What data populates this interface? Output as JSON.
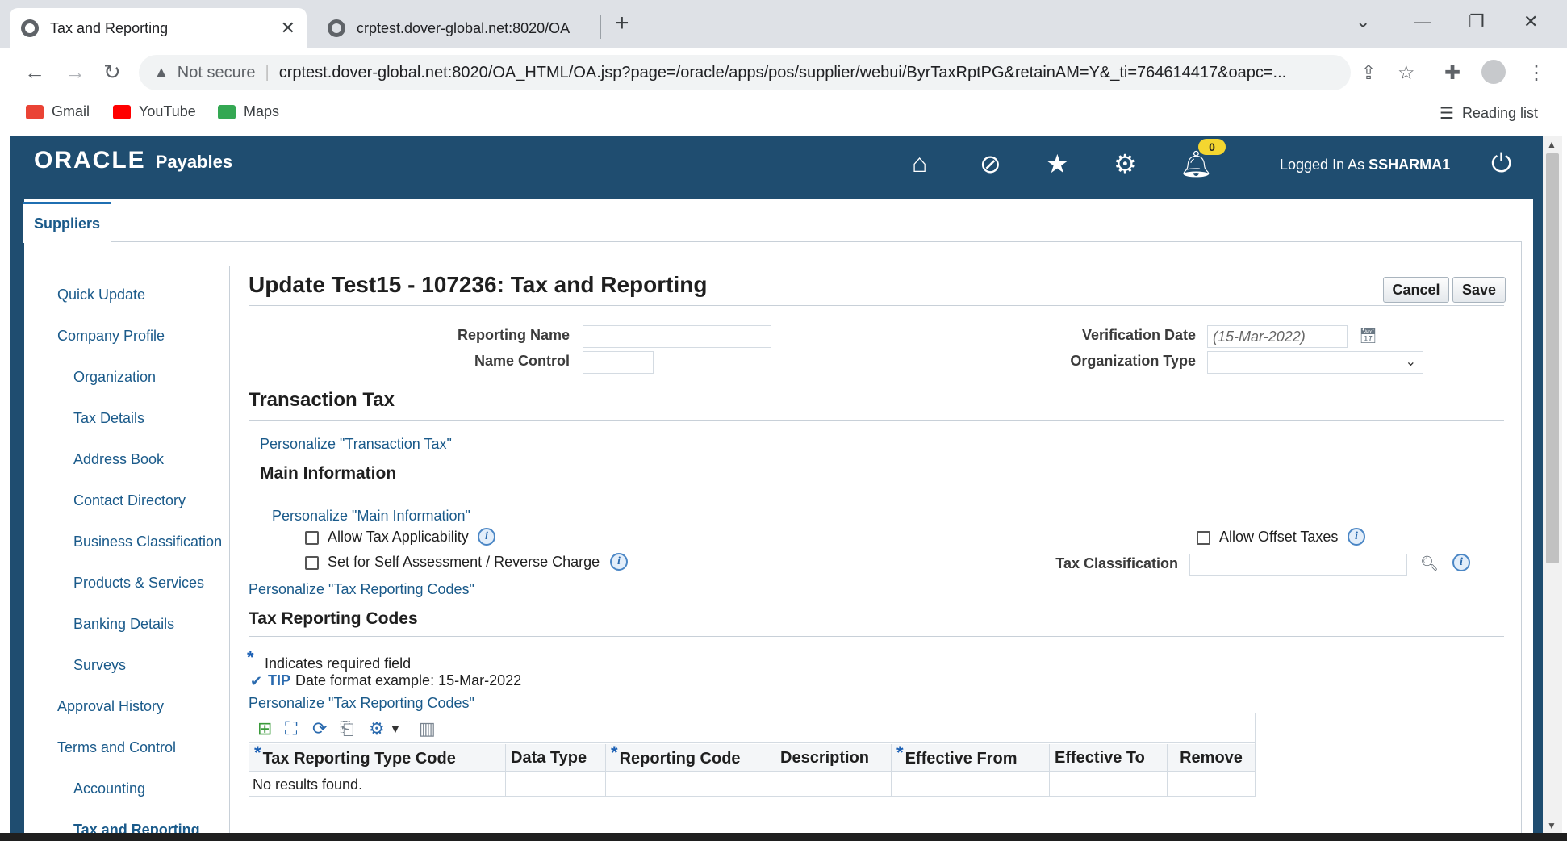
{
  "browser": {
    "tabs": [
      {
        "title": "Tax and Reporting",
        "active": true
      },
      {
        "title": "crptest.dover-global.net:8020/OA",
        "active": false
      }
    ],
    "new_tab": "+",
    "security_label": "Not secure",
    "url": "crptest.dover-global.net:8020/OA_HTML/OA.jsp?page=/oracle/apps/pos/supplier/webui/ByrTaxRptPG&retainAM=Y&_ti=764614417&oapc=...",
    "bookmarks": [
      "Gmail",
      "YouTube",
      "Maps"
    ],
    "reading_list": "Reading list"
  },
  "app": {
    "brand": "ORACLE",
    "product": "Payables",
    "notification_count": "0",
    "logged_in_prefix": "Logged In As",
    "user": "SSHARMA1",
    "colors": {
      "header": "#1f4d70",
      "link": "#1a5a8a",
      "required": "#1a5fb4"
    }
  },
  "tabs": {
    "suppliers": "Suppliers"
  },
  "left_nav": {
    "items": [
      {
        "label": "Quick Update",
        "indent": 0
      },
      {
        "label": "Company Profile",
        "indent": 0
      },
      {
        "label": "Organization",
        "indent": 1
      },
      {
        "label": "Tax Details",
        "indent": 1
      },
      {
        "label": "Address Book",
        "indent": 1
      },
      {
        "label": "Contact Directory",
        "indent": 1
      },
      {
        "label": "Business Classification",
        "indent": 1
      },
      {
        "label": "Products & Services",
        "indent": 1
      },
      {
        "label": "Banking Details",
        "indent": 1
      },
      {
        "label": "Surveys",
        "indent": 1
      },
      {
        "label": "Approval History",
        "indent": 0
      },
      {
        "label": "Terms and Control",
        "indent": 0
      },
      {
        "label": "Accounting",
        "indent": 1
      },
      {
        "label": "Tax and Reporting",
        "indent": 1
      }
    ]
  },
  "main": {
    "title": "Update Test15 - 107236: Tax and Reporting",
    "cancel": "Cancel",
    "save": "Save",
    "reporting_name_label": "Reporting Name",
    "reporting_name_value": "",
    "name_control_label": "Name Control",
    "name_control_value": "",
    "verification_date_label": "Verification Date",
    "verification_date_placeholder": "(15-Mar-2022)",
    "organization_type_label": "Organization Type",
    "organization_type_value": "",
    "transaction_tax": "Transaction Tax",
    "personalize_transaction_tax": "Personalize \"Transaction Tax\"",
    "main_information": "Main Information",
    "personalize_main_information": "Personalize \"Main Information\"",
    "allow_tax_applicability": "Allow Tax Applicability",
    "set_self_assessment": "Set for Self Assessment / Reverse Charge",
    "allow_offset_taxes": "Allow Offset Taxes",
    "tax_classification_label": "Tax Classification",
    "tax_classification_value": "",
    "personalize_tax_reporting_codes_1": "Personalize \"Tax Reporting Codes\"",
    "tax_reporting_codes": "Tax Reporting Codes",
    "required_star": "*",
    "required_note": "Indicates required field",
    "tip_label": "TIP",
    "tip_text": "Date format example: 15-Mar-2022",
    "personalize_tax_reporting_codes_2": "Personalize \"Tax Reporting Codes\""
  },
  "table": {
    "columns": [
      {
        "label": "Tax Reporting Type Code",
        "required": true
      },
      {
        "label": "Data Type",
        "required": false
      },
      {
        "label": "Reporting Code",
        "required": true
      },
      {
        "label": "Description",
        "required": false
      },
      {
        "label": "Effective From",
        "required": true
      },
      {
        "label": "Effective To",
        "required": false
      },
      {
        "label": "Remove",
        "required": false
      }
    ],
    "empty_message": "No results found."
  }
}
